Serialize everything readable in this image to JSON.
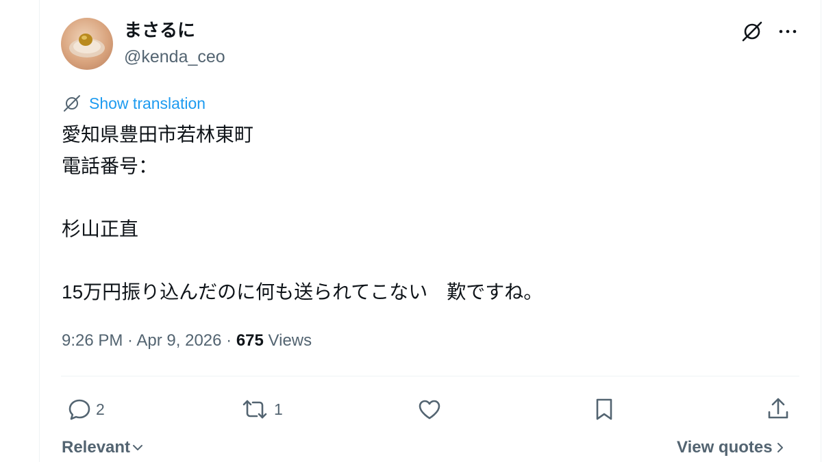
{
  "author": {
    "display_name": "まさるに",
    "handle": "@kenda_ceo"
  },
  "header_icons": {
    "grok": "grok-icon",
    "more": "more-icon"
  },
  "translation": {
    "label": "Show translation"
  },
  "tweet": {
    "lines": [
      "愛知県豊田市若林東町",
      "電話番号：",
      "",
      "杉山正直",
      "",
      "15万円振り込んだのに何も送られてこない　歎ですね。"
    ]
  },
  "meta": {
    "time": "9:26 PM",
    "separator": " · ",
    "date": "Apr 9, 2026",
    "views_count": "675",
    "views_label": " Views"
  },
  "actions": {
    "reply_count": "2",
    "repost_count": "1"
  },
  "footer": {
    "sort_label": "Relevant",
    "view_quotes_label": "View quotes"
  },
  "colors": {
    "accent": "#1d9bf0",
    "secondary_text": "#536471",
    "primary_text": "#0f1419",
    "divider": "#eff3f4"
  }
}
